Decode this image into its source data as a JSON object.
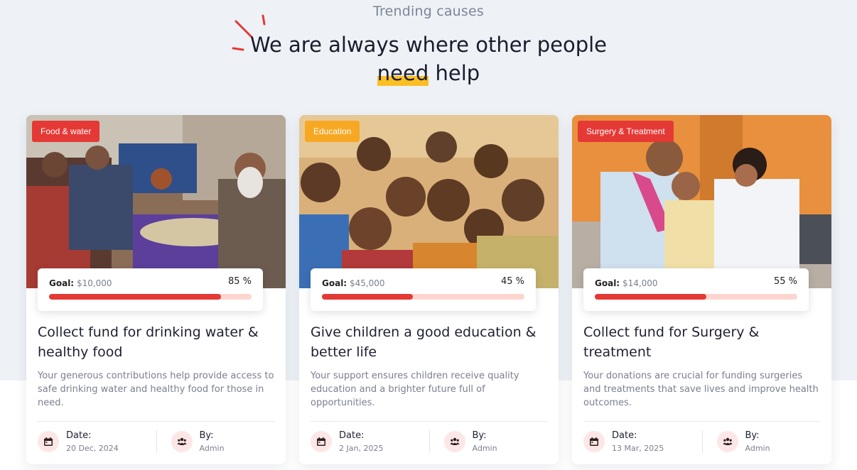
{
  "section": {
    "eyebrow": "Trending causes",
    "heading_line1": "We are always where other people",
    "heading_highlight": "need",
    "heading_rest": "help"
  },
  "cards": [
    {
      "badge": "Food & water",
      "badge_color": "#e53935",
      "goal_label": "Goal:",
      "goal_value": "$10,000",
      "percent_text": "85 %",
      "progress": 85,
      "title": "Collect fund for drinking water & healthy food",
      "description": "Your generous contributions help provide access to safe drinking water and healthy food for those in need.",
      "date_label": "Date:",
      "date_value": "20 Dec, 2024",
      "by_label": "By:",
      "by_value": "Admin"
    },
    {
      "badge": "Education",
      "badge_color": "#f7a823",
      "goal_label": "Goal:",
      "goal_value": "$45,000",
      "percent_text": "45 %",
      "progress": 45,
      "title": "Give children a good education & better life",
      "description": "Your support ensures children receive quality education and a brighter future full of opportunities.",
      "date_label": "Date:",
      "date_value": "2 Jan, 2025",
      "by_label": "By:",
      "by_value": "Admin"
    },
    {
      "badge": "Surgery & Treatment",
      "badge_color": "#e53935",
      "goal_label": "Goal:",
      "goal_value": "$14,000",
      "percent_text": "55 %",
      "progress": 55,
      "title": "Collect fund for Surgery & treatment",
      "description": "Your donations are crucial for funding surgeries and treatments that save lives and improve health outcomes.",
      "date_label": "Date:",
      "date_value": "13 Mar, 2025",
      "by_label": "By:",
      "by_value": "Admin"
    }
  ],
  "colors": {
    "accent": "#e53935",
    "highlight": "#fbbf24",
    "progress_track": "#fcd5cf"
  }
}
